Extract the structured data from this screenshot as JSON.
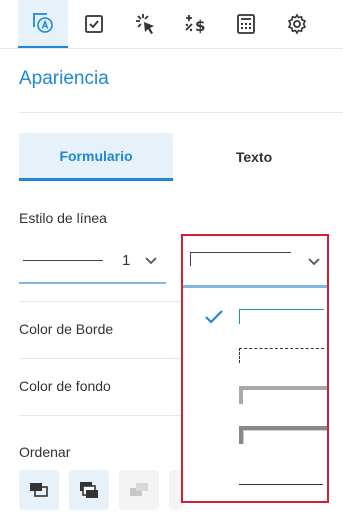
{
  "toolbar": {
    "icons": [
      "appearance-icon",
      "validation-icon",
      "action-icon",
      "calculation-icon",
      "calculator-icon",
      "settings-icon"
    ],
    "active_index": 0,
    "accent": "#1e88d6"
  },
  "panel": {
    "title": "Apariencia",
    "tabs": [
      {
        "label": "Formulario",
        "active": true
      },
      {
        "label": "Texto",
        "active": false
      }
    ],
    "line_style_label": "Estilo de línea",
    "line_width_value": "1",
    "border_color_label": "Color de Borde",
    "fill_color_label": "Color de fondo",
    "order_label": "Ordenar"
  },
  "dropdown": {
    "options": [
      {
        "style": "solid",
        "selected": true
      },
      {
        "style": "dashed",
        "selected": false
      },
      {
        "style": "beveled",
        "selected": false
      },
      {
        "style": "inset",
        "selected": false
      },
      {
        "style": "underline",
        "selected": false
      }
    ],
    "highlight_color": "#d32030"
  },
  "order_buttons": [
    {
      "name": "bring-to-front",
      "enabled": true
    },
    {
      "name": "send-to-back",
      "enabled": true
    },
    {
      "name": "bring-forward",
      "enabled": false
    },
    {
      "name": "send-backward",
      "enabled": false
    }
  ]
}
